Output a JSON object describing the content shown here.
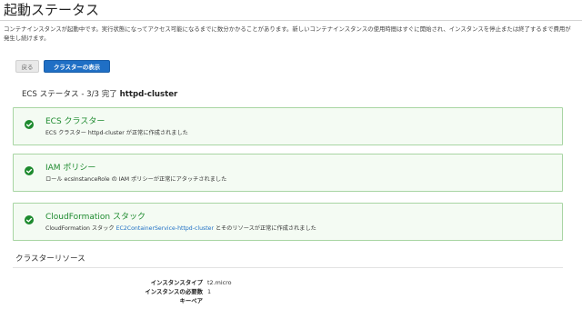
{
  "page": {
    "title": "起動ステータス",
    "description": "コンテナインスタンスが起動中です。実行状態になってアクセス可能になるまでに数分かかることがあります。新しいコンテナインスタンスの使用時間はすぐに開始され、インスタンスを停止または終了するまで費用が発生し続けます。"
  },
  "buttons": {
    "back": "戻る",
    "view_cluster": "クラスターの表示"
  },
  "status": {
    "heading_prefix": "ECS ステータス - 3/3 完了",
    "heading_cluster": "httpd-cluster",
    "items": [
      {
        "title": "ECS クラスター",
        "text": "ECS クラスター httpd-cluster が正常に作成されました"
      },
      {
        "title": "IAM ポリシー",
        "text": "ロール ecsInstanceRole の IAM ポリシーが正常にアタッチされました"
      },
      {
        "title": "CloudFormation スタック",
        "text_prefix": "CloudFormation スタック",
        "link": "EC2ContainerService-httpd-cluster",
        "text_suffix": "とそのリソースが正常に作成されました"
      }
    ]
  },
  "resources": {
    "heading": "クラスターリソース",
    "rows": [
      {
        "key": "インスタンスタイプ",
        "value": "t2.micro"
      },
      {
        "key": "インスタンスの必要数",
        "value": "1"
      },
      {
        "key": "キーペア",
        "value": ""
      }
    ]
  },
  "colors": {
    "success_green": "#1d8a2e",
    "success_border": "#a8d5a3",
    "primary_blue": "#1f6fc5"
  },
  "icons": {
    "status_check": "check-circle-icon"
  }
}
